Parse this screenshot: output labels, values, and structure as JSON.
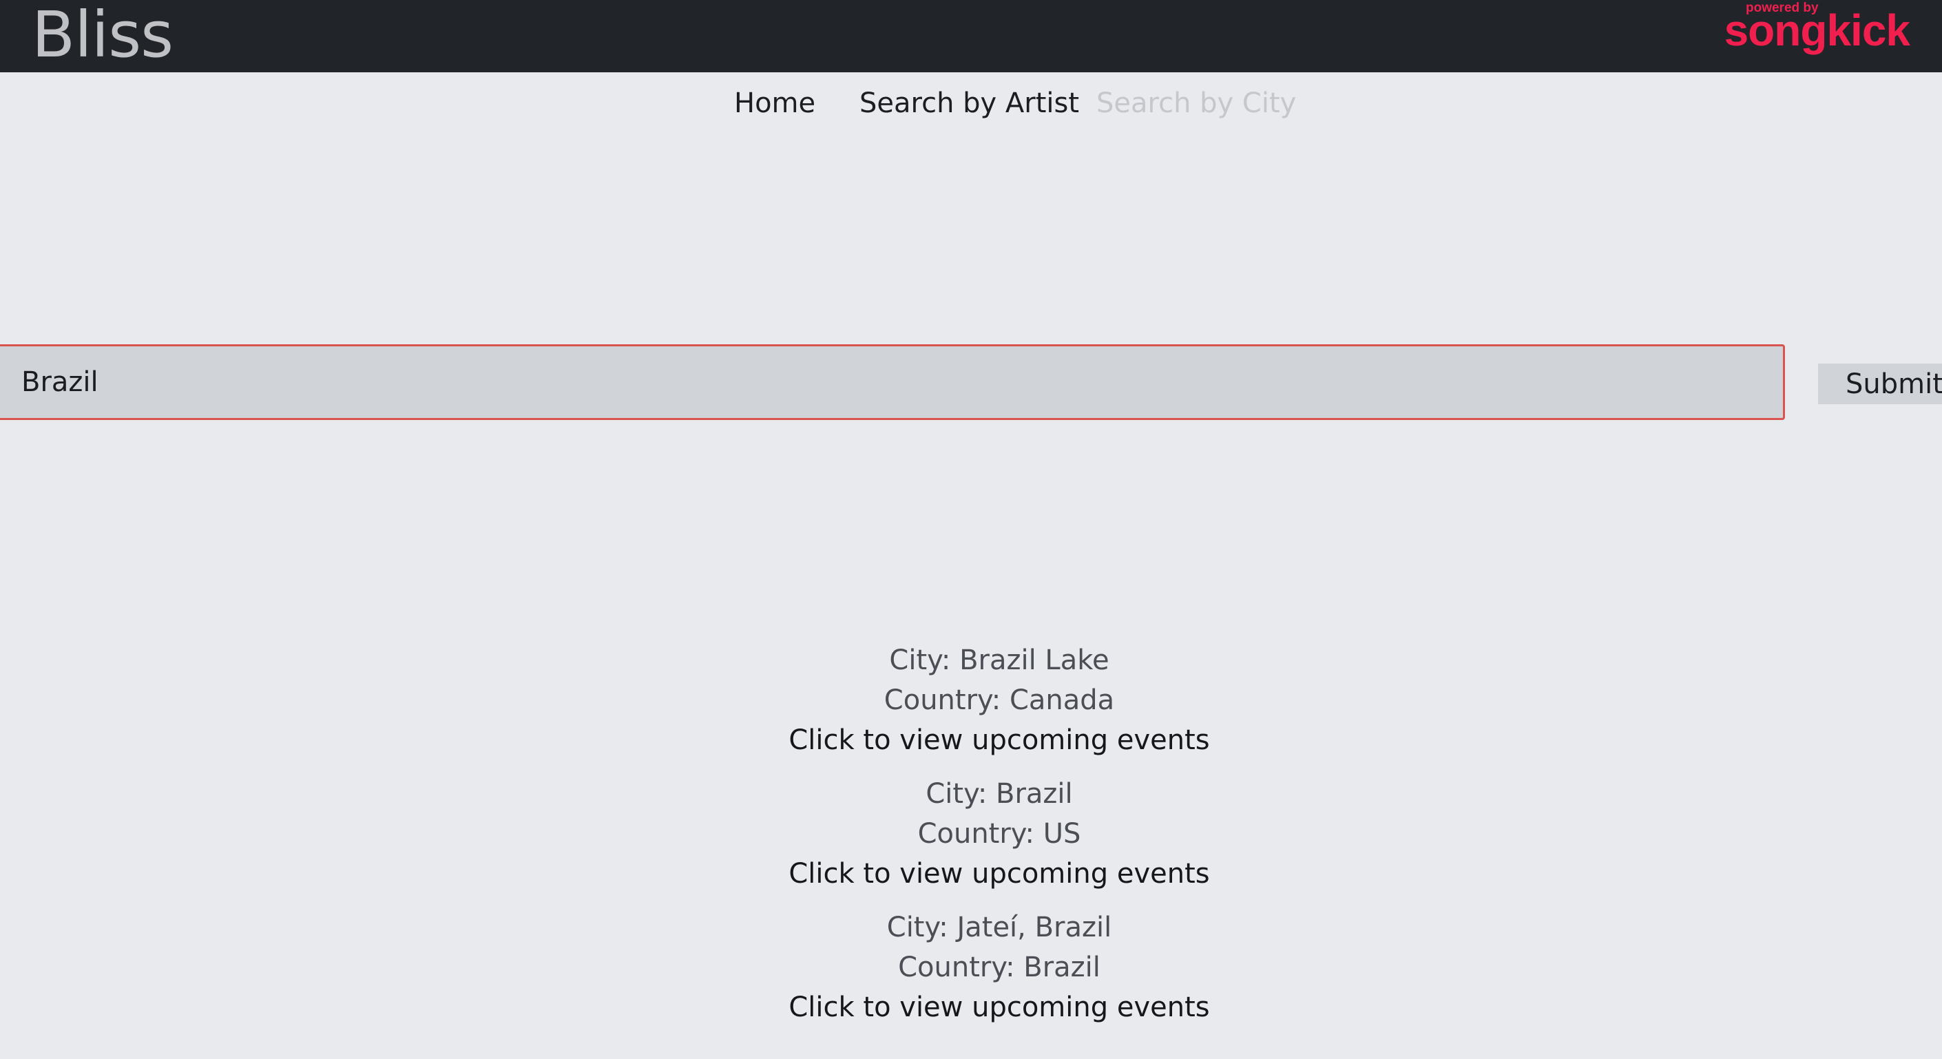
{
  "header": {
    "brand": "Bliss",
    "powered_by": "powered by",
    "partner_logo": "songkick",
    "partner_color": "#f01f4e"
  },
  "nav": {
    "home": "Home",
    "search_artist": "Search by Artist",
    "search_city": "Search by City"
  },
  "search": {
    "value": "Brazil",
    "submit_label": "Submit"
  },
  "results": [
    {
      "city": "City: Brazil Lake",
      "country": "Country: Canada",
      "link": "Click to view upcoming events"
    },
    {
      "city": "City: Brazil",
      "country": "Country: US",
      "link": "Click to view upcoming events"
    },
    {
      "city": "City: Jateí, Brazil",
      "country": "Country: Brazil",
      "link": "Click to view upcoming events"
    }
  ]
}
